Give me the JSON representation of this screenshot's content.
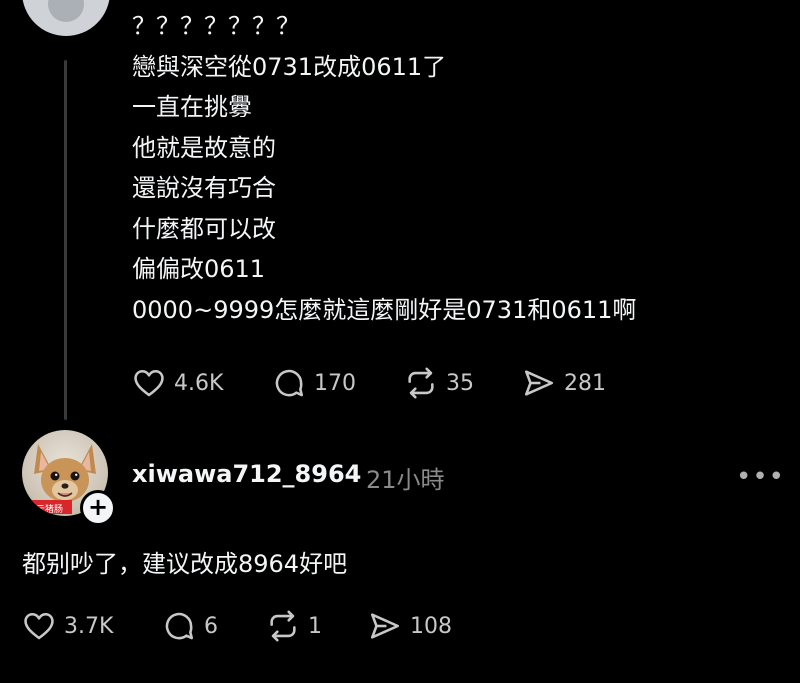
{
  "post": {
    "lines": [
      "？？？？？？？",
      "戀與深空從0731改成0611了",
      "一直在挑釁",
      "他就是故意的",
      "還說沒有巧合",
      "什麼都可以改",
      "偏偏改0611",
      "0000~9999怎麼就這麼剛好是0731和0611啊"
    ],
    "stats": {
      "likes": "4.6K",
      "comments": "170",
      "reposts": "35",
      "shares": "281"
    }
  },
  "reply": {
    "username": "xiwawa712_8964",
    "time": "21小時",
    "avatar_label": "云猪肠",
    "text": "都别吵了，建议改成8964好吧",
    "stats": {
      "likes": "3.7K",
      "comments": "6",
      "reposts": "1",
      "shares": "108"
    }
  },
  "icons": {
    "like": "heart-icon",
    "comment": "comment-icon",
    "repost": "repost-icon",
    "share": "send-icon",
    "more": "more-icon",
    "follow": "plus-icon"
  },
  "colors": {
    "background": "#000000",
    "text": "#f3f5f7",
    "muted": "#8a8a8a"
  }
}
